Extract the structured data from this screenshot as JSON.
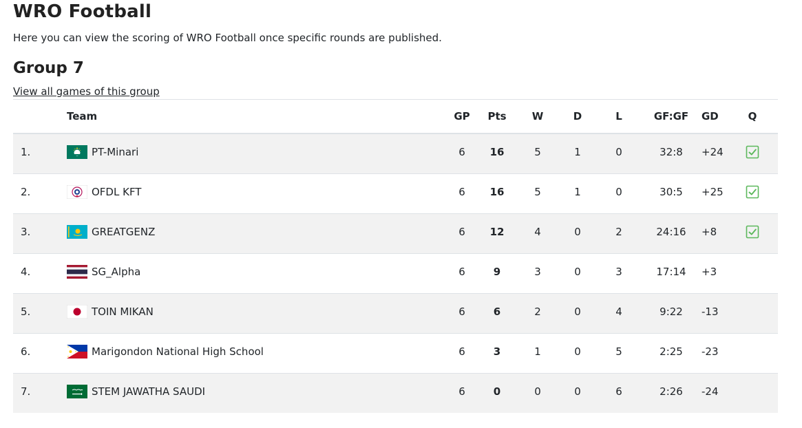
{
  "page": {
    "title": "WRO Football",
    "intro": "Here you can view the scoring of WRO Football once specific rounds are published."
  },
  "group": {
    "title": "Group 7",
    "link": "View all games of this group"
  },
  "table": {
    "headers": {
      "rank": "",
      "team": "Team",
      "gp": "GP",
      "pts": "Pts",
      "w": "W",
      "d": "D",
      "l": "L",
      "gfga": "GF:GF",
      "gd": "GD",
      "q": "Q"
    },
    "rows": [
      {
        "rank": "1.",
        "flag": "macau-flag-icon",
        "team": "PT-Minari",
        "gp": "6",
        "pts": "16",
        "w": "5",
        "d": "1",
        "l": "0",
        "gfga": "32:8",
        "gd": "+24",
        "qualified": true
      },
      {
        "rank": "2.",
        "flag": "chinese-taipei-flag-icon",
        "team": "OFDL KFT",
        "gp": "6",
        "pts": "16",
        "w": "5",
        "d": "1",
        "l": "0",
        "gfga": "30:5",
        "gd": "+25",
        "qualified": true
      },
      {
        "rank": "3.",
        "flag": "kazakhstan-flag-icon",
        "team": "GREATGENZ",
        "gp": "6",
        "pts": "12",
        "w": "4",
        "d": "0",
        "l": "2",
        "gfga": "24:16",
        "gd": "+8",
        "qualified": true
      },
      {
        "rank": "4.",
        "flag": "thailand-flag-icon",
        "team": "SG_Alpha",
        "gp": "6",
        "pts": "9",
        "w": "3",
        "d": "0",
        "l": "3",
        "gfga": "17:14",
        "gd": "+3",
        "qualified": false
      },
      {
        "rank": "5.",
        "flag": "japan-flag-icon",
        "team": "TOIN MIKAN",
        "gp": "6",
        "pts": "6",
        "w": "2",
        "d": "0",
        "l": "4",
        "gfga": "9:22",
        "gd": "-13",
        "qualified": false
      },
      {
        "rank": "6.",
        "flag": "philippines-flag-icon",
        "team": "Marigondon National High School",
        "gp": "6",
        "pts": "3",
        "w": "1",
        "d": "0",
        "l": "5",
        "gfga": "2:25",
        "gd": "-23",
        "qualified": false
      },
      {
        "rank": "7.",
        "flag": "saudi-arabia-flag-icon",
        "team": "STEM JAWATHA SAUDI",
        "gp": "6",
        "pts": "0",
        "w": "0",
        "d": "0",
        "l": "6",
        "gfga": "2:26",
        "gd": "-24",
        "qualified": false
      }
    ]
  },
  "colors": {
    "check": "#5cb85c",
    "stripe": "#f2f2f2",
    "border": "#dee2e6"
  }
}
